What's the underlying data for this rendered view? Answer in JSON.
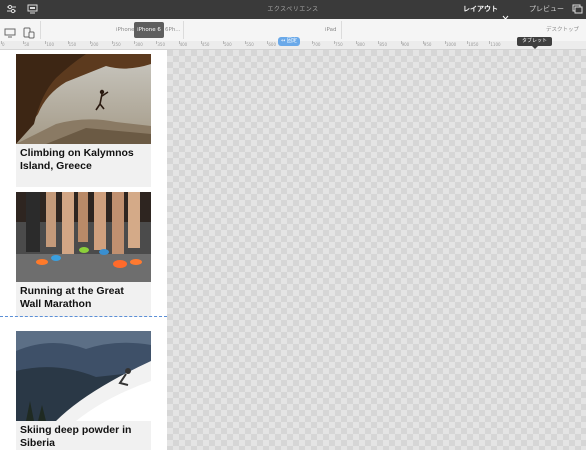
{
  "app": {
    "title": "エクスペリエンス",
    "layout_label": "レイアウト",
    "preview_label": "プレビュー"
  },
  "devices": {
    "iphone_label": "iPhone",
    "iphone6_label": "iPhone 6",
    "iphone6plus_label": "6Ph...",
    "ipad_label": "iPad",
    "desktop_label": "デスクトップ"
  },
  "ruler": {
    "labels": [
      "0",
      "50",
      "100",
      "150",
      "200",
      "250",
      "300",
      "350",
      "400",
      "450",
      "500",
      "550",
      "600",
      "650",
      "700",
      "750",
      "800",
      "850",
      "900",
      "950",
      "1000",
      "1050",
      "1100"
    ],
    "pin_label": "↔ 固定",
    "tooltip": "タブレット"
  },
  "cards": [
    {
      "caption": "Climbing on Kalymnos Island, Greece"
    },
    {
      "caption": "Running at the Great Wall Marathon"
    },
    {
      "caption": "Skiing deep powder in Siberia"
    }
  ],
  "icons": {
    "top_left": "slider-settings-icon",
    "top_left2": "screen-device-icon",
    "top_right": "copy-window-icon",
    "desktop": "desktop-monitor-icon",
    "mobile": "mobile-devices-icon"
  }
}
